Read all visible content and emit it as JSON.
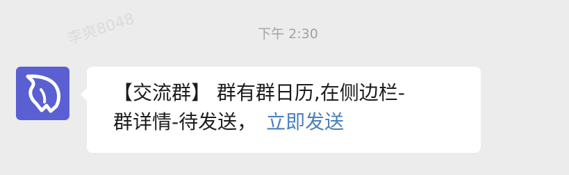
{
  "watermark": "李爽8048",
  "timestamp": "下午 2:30",
  "message": {
    "line1": "【交流群】 群有群日历,在侧边栏-",
    "line2": "群详情-待发送，",
    "link_text": "立即发送"
  },
  "colors": {
    "background": "#ececec",
    "avatar_bg": "#5a5fd2",
    "bubble_bg": "#ffffff",
    "link": "#4a7fbd",
    "timestamp": "#a2a2a2"
  },
  "icons": {
    "avatar": "horse-head-logo-icon"
  }
}
